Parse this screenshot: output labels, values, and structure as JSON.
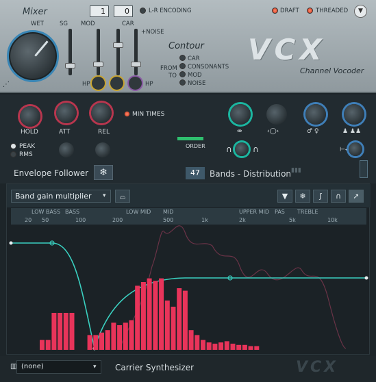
{
  "mixer": {
    "title": "Mixer",
    "wet_label": "WET",
    "sg_label": "SG",
    "mod_label": "MOD",
    "car_label": "CAR",
    "noise_label": "+NOISE",
    "hp_left": "HP",
    "hp_right": "HP",
    "value1": "1",
    "value2": "0",
    "lr_label": "L-R ENCODING",
    "draft_label": "DRAFT",
    "threaded_label": "THREADED"
  },
  "contour": {
    "title": "Contour",
    "from_label": "FROM",
    "to_label": "TO",
    "options": [
      "CAR",
      "CONSONANTS",
      "MOD",
      "NOISE"
    ]
  },
  "brand": {
    "logo": "VCX",
    "subtitle": "Channel Vocoder"
  },
  "envelope": {
    "hold": "HOLD",
    "att": "ATT",
    "rel": "REL",
    "min_times": "MIN TIMES",
    "peak": "PEAK",
    "rms": "RMS",
    "title": "Envelope Follower",
    "order": "ORDER"
  },
  "bands": {
    "count": "47",
    "label": "Bands - Distribution"
  },
  "graph": {
    "dropdown": "Band gain multiplier",
    "ranges": [
      "LOW BASS",
      "BASS",
      "LOW MID",
      "MID",
      "UPPER MID",
      "PAS",
      "TREBLE"
    ],
    "ticks": [
      "20",
      "50",
      "100",
      "200",
      "500",
      "1k",
      "2k",
      "5k",
      "10k"
    ]
  },
  "footer": {
    "preset": "(none)",
    "label": "Carrier Synthesizer",
    "logo": "VCX"
  },
  "chart_data": {
    "type": "bar",
    "series": [
      {
        "values": [
          0.08,
          0.08,
          0.3,
          0.3,
          0.3,
          0.3,
          0,
          0,
          0.12,
          0.12,
          0.14,
          0.16,
          0.22,
          0.2,
          0.22,
          0.24,
          0.52,
          0.55,
          0.58,
          0.56,
          0.58,
          0.4,
          0.35,
          0.5,
          0.48,
          0.16,
          0.12,
          0.08,
          0.06,
          0.05,
          0.06,
          0.07,
          0.05,
          0.04,
          0.04,
          0.03,
          0.03
        ]
      }
    ],
    "colors": {
      "bars": "#e8345a",
      "curve": "#3ad0c0",
      "envelope": "#7a3a4a"
    }
  }
}
